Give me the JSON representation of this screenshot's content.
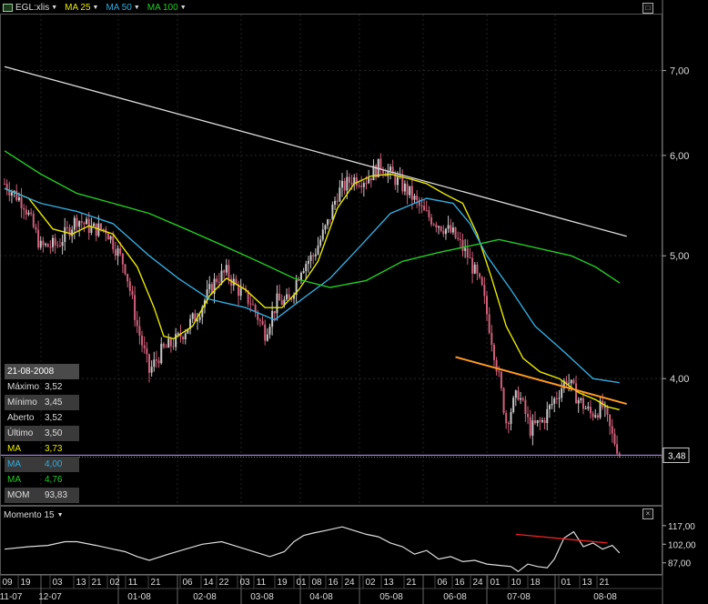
{
  "toolbar": {
    "symbol": "EGL:xlis",
    "indicators": [
      {
        "label": "MA 25",
        "color": "#e8e800"
      },
      {
        "label": "MA 50",
        "color": "#33aadd"
      },
      {
        "label": "MA 100",
        "color": "#22cc22"
      }
    ]
  },
  "info_panel": {
    "date": "21-08-2008",
    "rows": [
      {
        "label": "Máximo",
        "value": "3,52",
        "color": "#dddddd"
      },
      {
        "label": "Mínimo",
        "value": "3,45",
        "color": "#dddddd"
      },
      {
        "label": "Aberto",
        "value": "3,52",
        "color": "#dddddd"
      },
      {
        "label": "Último",
        "value": "3,50",
        "color": "#dddddd"
      },
      {
        "label": "MA",
        "value": "3,73",
        "color": "#e8e800"
      },
      {
        "label": "MA",
        "value": "4,00",
        "color": "#33aadd"
      },
      {
        "label": "MA",
        "value": "4,76",
        "color": "#22cc22"
      },
      {
        "label": "MOM",
        "value": "93,83",
        "color": "#dddddd"
      }
    ]
  },
  "momentum_panel": {
    "title": "Momento 15"
  },
  "last_price_label": "3,48",
  "colors": {
    "up": "#c8c8c8",
    "down": "#d0607a",
    "ma25": "#e8e800",
    "ma50": "#33aadd",
    "ma100": "#22cc22",
    "trend_white": "#dddddd",
    "trend_orange": "#ff9922",
    "trend_red": "#ee2222",
    "last_line": "#aa88ee"
  },
  "chart_data": {
    "type": "line",
    "price_axis": {
      "ticks": [
        "7,00",
        "6,00",
        "5,00",
        "4,00"
      ],
      "tick_values": [
        7.0,
        6.0,
        5.0,
        4.0
      ],
      "scale": "log"
    },
    "momentum_axis": {
      "ticks": [
        "117,00",
        "102,00",
        "87,00"
      ],
      "tick_values": [
        117,
        102,
        87
      ]
    },
    "x_day_labels": [
      "09",
      "19",
      "03",
      "13",
      "21",
      "02",
      "11",
      "21",
      "06",
      "14",
      "22",
      "03",
      "11",
      "19",
      "01",
      "08",
      "16",
      "24",
      "02",
      "13",
      "21",
      "06",
      "16",
      "24",
      "01",
      "10",
      "18",
      "01",
      "13",
      "21"
    ],
    "x_month_labels": [
      "11-07",
      "12-07",
      "01-08",
      "02-08",
      "03-08",
      "04-08",
      "05-08",
      "06-08",
      "07-08",
      "08-08"
    ],
    "close_anchors": [
      {
        "x": 0,
        "y": 5.7
      },
      {
        "x": 8,
        "y": 5.5
      },
      {
        "x": 15,
        "y": 5.08
      },
      {
        "x": 22,
        "y": 5.1
      },
      {
        "x": 30,
        "y": 5.35
      },
      {
        "x": 36,
        "y": 5.25
      },
      {
        "x": 42,
        "y": 5.25
      },
      {
        "x": 50,
        "y": 4.9
      },
      {
        "x": 55,
        "y": 4.4
      },
      {
        "x": 60,
        "y": 4.05
      },
      {
        "x": 65,
        "y": 4.2
      },
      {
        "x": 72,
        "y": 4.3
      },
      {
        "x": 80,
        "y": 4.5
      },
      {
        "x": 88,
        "y": 4.8
      },
      {
        "x": 92,
        "y": 4.85
      },
      {
        "x": 97,
        "y": 4.7
      },
      {
        "x": 102,
        "y": 4.6
      },
      {
        "x": 108,
        "y": 4.35
      },
      {
        "x": 113,
        "y": 4.6
      },
      {
        "x": 118,
        "y": 4.6
      },
      {
        "x": 123,
        "y": 4.9
      },
      {
        "x": 128,
        "y": 5.0
      },
      {
        "x": 134,
        "y": 5.3
      },
      {
        "x": 138,
        "y": 5.6
      },
      {
        "x": 144,
        "y": 5.75
      },
      {
        "x": 150,
        "y": 5.75
      },
      {
        "x": 156,
        "y": 5.9
      },
      {
        "x": 162,
        "y": 5.75
      },
      {
        "x": 168,
        "y": 5.6
      },
      {
        "x": 174,
        "y": 5.4
      },
      {
        "x": 180,
        "y": 5.3
      },
      {
        "x": 186,
        "y": 5.2
      },
      {
        "x": 192,
        "y": 5.0
      },
      {
        "x": 198,
        "y": 4.7
      },
      {
        "x": 203,
        "y": 4.2
      },
      {
        "x": 208,
        "y": 3.7
      },
      {
        "x": 213,
        "y": 3.9
      },
      {
        "x": 218,
        "y": 3.65
      },
      {
        "x": 223,
        "y": 3.7
      },
      {
        "x": 228,
        "y": 3.85
      },
      {
        "x": 233,
        "y": 4.0
      },
      {
        "x": 238,
        "y": 3.85
      },
      {
        "x": 243,
        "y": 3.75
      },
      {
        "x": 248,
        "y": 3.8
      },
      {
        "x": 252,
        "y": 3.6
      },
      {
        "x": 255,
        "y": 3.5
      }
    ],
    "series": [
      {
        "name": "MA 25",
        "x": [
          0,
          10,
          20,
          28,
          35,
          45,
          55,
          62,
          66,
          70,
          78,
          85,
          92,
          100,
          108,
          115,
          122,
          130,
          138,
          145,
          152,
          160,
          168,
          175,
          182,
          190,
          196,
          202,
          208,
          215,
          222,
          230,
          238,
          245,
          250,
          255
        ],
        "y": [
          5.65,
          5.55,
          5.25,
          5.2,
          5.28,
          5.2,
          4.9,
          4.55,
          4.32,
          4.3,
          4.4,
          4.65,
          4.8,
          4.7,
          4.55,
          4.55,
          4.7,
          4.95,
          5.45,
          5.7,
          5.78,
          5.8,
          5.75,
          5.7,
          5.6,
          5.5,
          5.2,
          4.8,
          4.4,
          4.15,
          4.05,
          4.0,
          3.9,
          3.85,
          3.8,
          3.78
        ]
      },
      {
        "name": "MA 50",
        "x": [
          0,
          15,
          30,
          45,
          60,
          72,
          85,
          100,
          112,
          122,
          135,
          148,
          160,
          175,
          186,
          193,
          200,
          210,
          220,
          232,
          244,
          255
        ],
        "y": [
          5.65,
          5.5,
          5.42,
          5.3,
          5.0,
          4.8,
          4.62,
          4.55,
          4.45,
          4.6,
          4.8,
          5.1,
          5.4,
          5.55,
          5.5,
          5.3,
          5.0,
          4.7,
          4.4,
          4.2,
          4.0,
          3.97
        ]
      },
      {
        "name": "MA 100",
        "x": [
          0,
          15,
          30,
          45,
          60,
          75,
          90,
          105,
          120,
          135,
          150,
          165,
          180,
          195,
          205,
          215,
          225,
          235,
          245,
          255
        ],
        "y": [
          6.05,
          5.8,
          5.6,
          5.5,
          5.4,
          5.25,
          5.1,
          4.95,
          4.8,
          4.72,
          4.78,
          4.95,
          5.03,
          5.1,
          5.15,
          5.1,
          5.05,
          5.0,
          4.9,
          4.76
        ]
      },
      {
        "name": "Momento 15",
        "x": [
          0,
          10,
          18,
          25,
          30,
          38,
          45,
          50,
          55,
          60,
          68,
          75,
          82,
          90,
          100,
          105,
          110,
          116,
          120,
          124,
          128,
          133,
          140,
          145,
          150,
          155,
          160,
          165,
          170,
          175,
          180,
          185,
          190,
          195,
          200,
          205,
          210,
          213,
          217,
          221,
          225,
          228,
          232,
          236,
          240,
          244,
          248,
          252,
          255
        ],
        "y": [
          98,
          100,
          101,
          104,
          104,
          101,
          98,
          96,
          92,
          89,
          94,
          98,
          102,
          104,
          98,
          95,
          92,
          96,
          104,
          109,
          111,
          113,
          116,
          113,
          110,
          108,
          103,
          100,
          94,
          97,
          90,
          92,
          88,
          89,
          86,
          85,
          84,
          80,
          86,
          84,
          83,
          90,
          107,
          112,
          100,
          103,
          98,
          101,
          95
        ]
      }
    ],
    "trendlines": [
      {
        "name": "resistance-white",
        "color": "#dddddd",
        "from": [
          0,
          7.05
        ],
        "to": [
          258,
          5.18
        ]
      },
      {
        "name": "resistance-orange",
        "color": "#ff9922",
        "from": [
          187,
          4.16
        ],
        "to": [
          258,
          3.82
        ]
      },
      {
        "name": "momentum-red",
        "color": "#ee2222",
        "panel": "momentum",
        "from": [
          212,
          110
        ],
        "to": [
          250,
          103
        ]
      }
    ],
    "horizontal_line": {
      "value": 3.48,
      "color": "#aa88ee"
    },
    "grid": true,
    "legend": "top-left"
  }
}
